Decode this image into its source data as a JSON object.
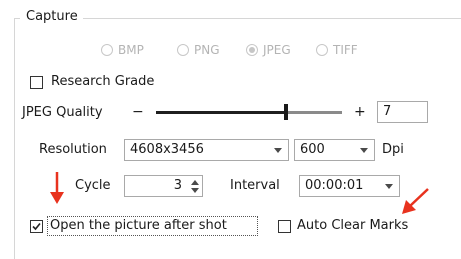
{
  "group": {
    "title": "Capture"
  },
  "format": {
    "options": [
      "BMP",
      "PNG",
      "JPEG",
      "TIFF"
    ],
    "selected": "JPEG",
    "enabled": false
  },
  "research_grade": {
    "label": "Research Grade",
    "checked": false
  },
  "jpeg_quality": {
    "label": "JPEG Quality",
    "minus": "−",
    "plus": "+",
    "value": "7",
    "slider_fraction": 0.7
  },
  "resolution": {
    "label": "Resolution",
    "size_value": "4608x3456",
    "dpi_value": "600",
    "dpi_unit": "Dpi"
  },
  "cycle": {
    "label": "Cycle",
    "value": "3"
  },
  "interval": {
    "label": "Interval",
    "value": "00:00:01"
  },
  "open_after_shot": {
    "label": "Open the picture after shot",
    "checked": true
  },
  "auto_clear_marks": {
    "label": "Auto Clear Marks",
    "checked": false
  },
  "colors": {
    "annotation_arrow": "#e8321e",
    "disabled_text": "#b4b4b4"
  }
}
